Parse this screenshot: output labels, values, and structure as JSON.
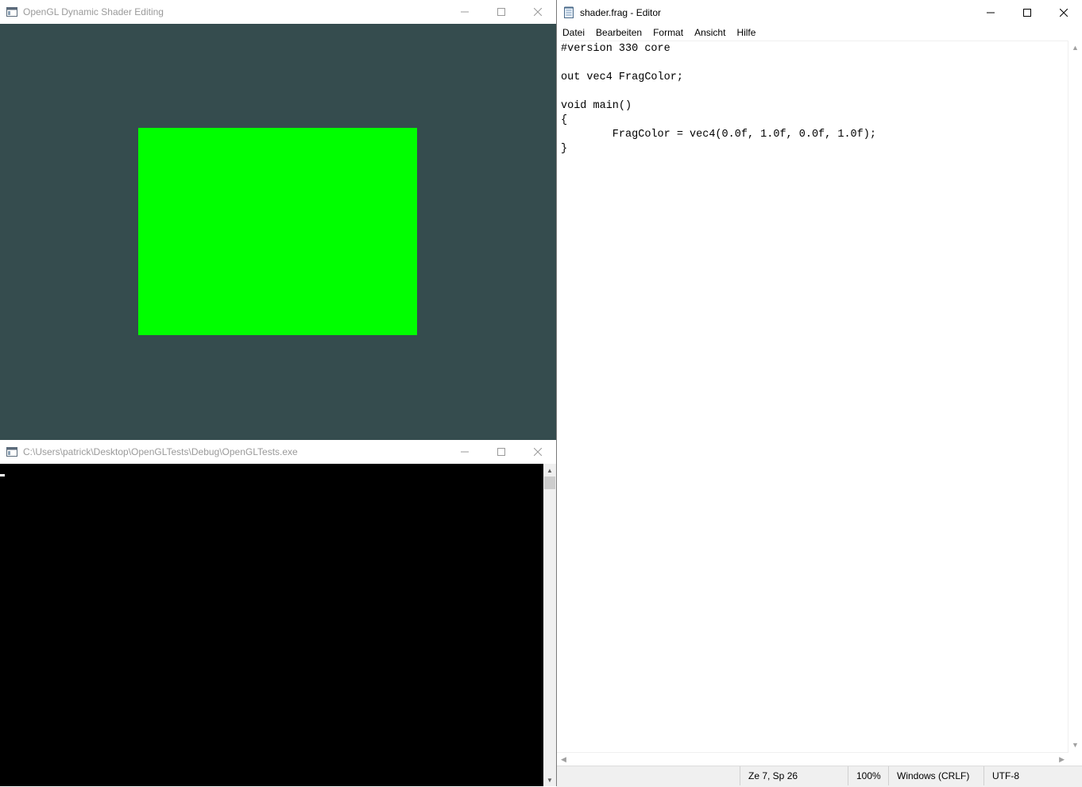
{
  "gl_window": {
    "title": "OpenGL Dynamic Shader Editing",
    "clear_color": "#354c4e",
    "quad_color": "#00ff00",
    "buttons": {
      "minimize_icon": "minimize-icon",
      "maximize_icon": "maximize-icon",
      "close_icon": "close-icon"
    }
  },
  "console_window": {
    "title": "C:\\Users\\patrick\\Desktop\\OpenGLTests\\Debug\\OpenGLTests.exe",
    "background": "#000000"
  },
  "editor": {
    "title": "shader.frag - Editor",
    "menu": [
      "Datei",
      "Bearbeiten",
      "Format",
      "Ansicht",
      "Hilfe"
    ],
    "lines": [
      "#version 330 core",
      "",
      "out vec4 FragColor;",
      "",
      "void main()",
      "{",
      "        FragColor = vec4(0.0f, 1.0f, 0.0f, 1.0f);",
      "}"
    ],
    "status": {
      "position": "Ze 7, Sp 26",
      "zoom": "100%",
      "line_ending": "Windows (CRLF)",
      "encoding": "UTF-8"
    }
  }
}
